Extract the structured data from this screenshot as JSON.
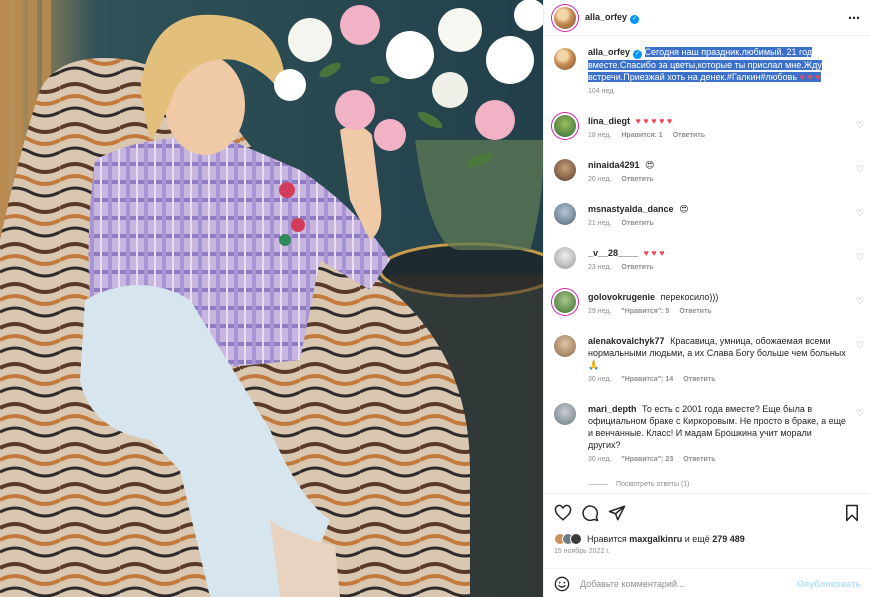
{
  "post": {
    "author": "alla_orfey",
    "more_icon": "⋯"
  },
  "caption": {
    "author": "alla_orfey",
    "text": "Сегодня наш праздник.любимый. 21 год вместе.Спасибо за цветы,которые ты прислал мне.Жду встречи.Приезжай хоть на денек.#Галкин#любовь",
    "emoji": "♥ ♥ ♥",
    "time": "104 нед."
  },
  "comments": [
    {
      "user": "lina_diegt",
      "text": "",
      "emoji": "♥ ♥ ♥ ♥ ♥",
      "time": "18 нед.",
      "likes": "Нравится: 1",
      "reply": "Ответить"
    },
    {
      "user": "ninaida4291",
      "text": "",
      "emoji": "😍",
      "time": "20 нед.",
      "likes": "",
      "reply": "Ответить"
    },
    {
      "user": "msnastyalda_dance",
      "text": "",
      "emoji": "😍",
      "time": "21 нед.",
      "likes": "",
      "reply": "Ответить"
    },
    {
      "user": "_v__28____",
      "text": "",
      "emoji": "♥ ♥ ♥",
      "time": "23 нед.",
      "likes": "",
      "reply": "Ответить"
    },
    {
      "user": "golovokrugenie",
      "text": "перекосило)))",
      "emoji": "",
      "time": "29 нед.",
      "likes": "\"Нравится\": 5",
      "reply": "Ответить"
    },
    {
      "user": "alenakovalchyk77",
      "text": "Красавица, умница, обожаемая всеми нормальными людьми, а их Слава Богу больше чем больных",
      "emoji": "🙏",
      "time": "30 нед.",
      "likes": "\"Нравится\": 14",
      "reply": "Ответить"
    },
    {
      "user": "mari_depth",
      "text": "То есть с 2001 года вместе? Еще была в официальном браке с Киркоровым. Не просто в браке, а еще и венчанные. Класс! И мадам Брошкина учит морали других?",
      "emoji": "",
      "time": "30 нед.",
      "likes": "\"Нравится\": 23",
      "reply": "Ответить"
    }
  ],
  "view_replies": "Посмотреть ответы (1)",
  "likes_line": {
    "prefix": "Нравится",
    "user": "maxgalkinru",
    "suffix": "и ещё",
    "count": "279 489"
  },
  "date": "15 ноябрь 2022 г.",
  "add_comment": {
    "placeholder": "Добавьте комментарий...",
    "publish": "Опубликовать"
  },
  "colors": {
    "accent": "#0095f6",
    "highlight": "#3b71ca",
    "heart_red": "#ed4956",
    "muted": "#8e8e8e"
  },
  "icons": {
    "like": "heart-outline-icon",
    "comment": "comment-icon",
    "share": "paper-plane-icon",
    "save": "bookmark-icon",
    "emoji": "smiley-icon"
  }
}
